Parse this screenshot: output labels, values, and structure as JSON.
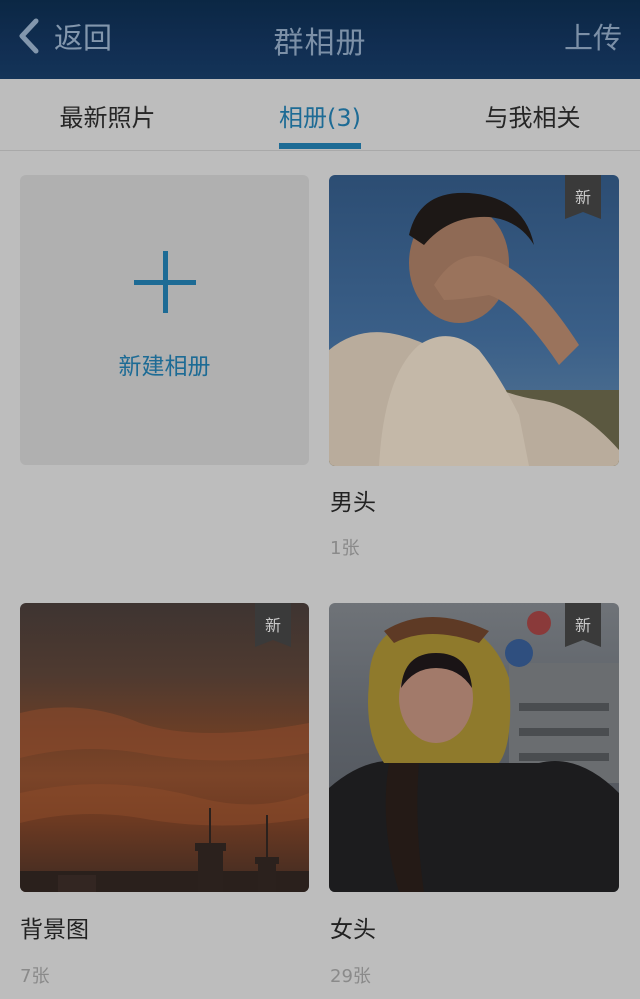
{
  "header": {
    "back_label": "返回",
    "title": "群相册",
    "upload_label": "上传"
  },
  "tabs": [
    {
      "label": "最新照片",
      "active": false
    },
    {
      "label": "相册(3)",
      "active": true
    },
    {
      "label": "与我相关",
      "active": false
    }
  ],
  "new_album": {
    "label": "新建相册",
    "icon": "plus-icon"
  },
  "albums": [
    {
      "name": "男头",
      "count": "1张",
      "badge": "新"
    },
    {
      "name": "背景图",
      "count": "7张",
      "badge": "新"
    },
    {
      "name": "女头",
      "count": "29张",
      "badge": "新"
    }
  ],
  "colors": {
    "accent": "#1d6b95",
    "header_bg": "#0b2744",
    "page_bg": "#bdbdbd"
  }
}
